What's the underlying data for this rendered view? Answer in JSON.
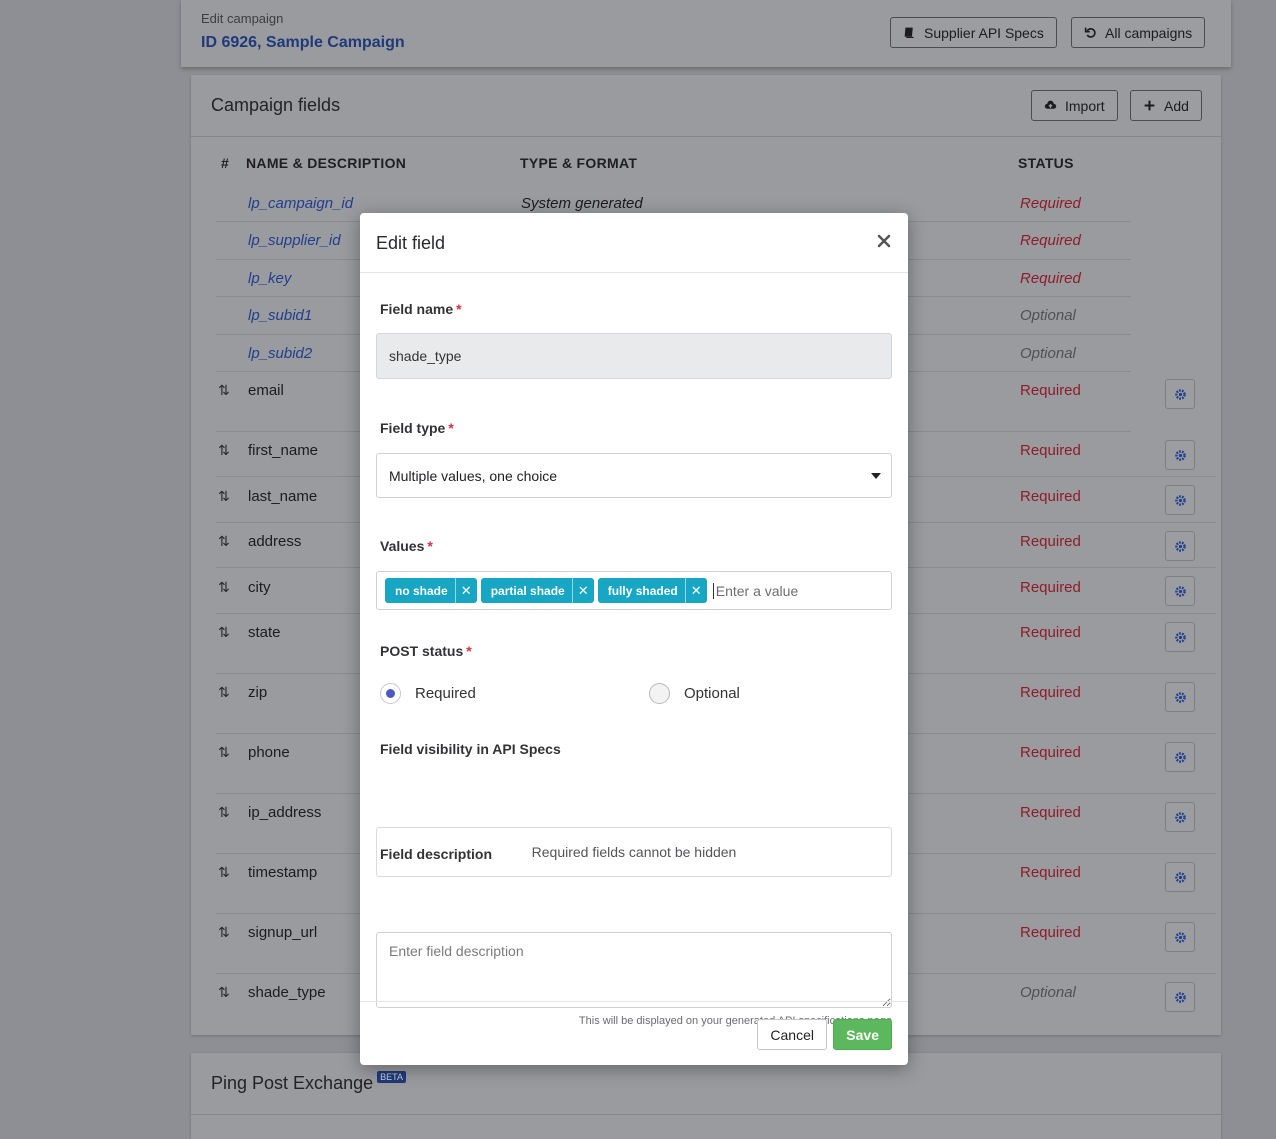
{
  "header": {
    "eyebrow": "Edit campaign",
    "title": "ID 6926, Sample Campaign",
    "api_specs_label": "Supplier API Specs",
    "all_campaigns_label": "All campaigns"
  },
  "fields_card": {
    "title": "Campaign fields",
    "import_label": "Import",
    "add_label": "Add",
    "columns": {
      "num": "#",
      "name": "NAME & DESCRIPTION",
      "type": "TYPE & FORMAT",
      "status": "STATUS"
    },
    "system_rows": [
      {
        "name": "lp_campaign_id",
        "type": "System generated",
        "status": "Required"
      },
      {
        "name": "lp_supplier_id",
        "type": "",
        "status": "Required"
      },
      {
        "name": "lp_key",
        "type": "",
        "status": "Required"
      },
      {
        "name": "lp_subid1",
        "type": "",
        "status": "Optional"
      },
      {
        "name": "lp_subid2",
        "type": "",
        "status": "Optional"
      }
    ],
    "rows": [
      {
        "name": "email",
        "status": "Required"
      },
      {
        "name": "first_name",
        "status": "Required"
      },
      {
        "name": "last_name",
        "status": "Required"
      },
      {
        "name": "address",
        "status": "Required"
      },
      {
        "name": "city",
        "status": "Required"
      },
      {
        "name": "state",
        "status": "Required"
      },
      {
        "name": "zip",
        "status": "Required"
      },
      {
        "name": "phone",
        "status": "Required"
      },
      {
        "name": "ip_address",
        "status": "Required"
      },
      {
        "name": "timestamp",
        "status": "Required"
      },
      {
        "name": "signup_url",
        "status": "Required"
      },
      {
        "name": "shade_type",
        "status": "Optional"
      }
    ]
  },
  "ping_card": {
    "title": "Ping Post Exchange",
    "badge": "BETA"
  },
  "modal": {
    "title": "Edit field",
    "field_name_label": "Field name",
    "field_name_value": "shade_type",
    "field_type_label": "Field type",
    "field_type_value": "Multiple values, one choice",
    "values_label": "Values",
    "values": [
      "no shade",
      "partial shade",
      "fully shaded"
    ],
    "values_placeholder": "Enter a value",
    "post_status_label": "POST status",
    "post_status_options": [
      "Required",
      "Optional"
    ],
    "post_status_selected": "Required",
    "visibility_label": "Field visibility in API Specs",
    "visibility_text": "Required fields cannot be hidden",
    "description_label": "Field description",
    "description_placeholder": "Enter field description",
    "description_hint": "This will be displayed on your generated API specifications page",
    "cancel_label": "Cancel",
    "save_label": "Save",
    "required_marker": "*"
  },
  "colors": {
    "tag_bg": "#17a7c4",
    "save_bg": "#5cb85c",
    "radio_accent": "#4c5ac2",
    "required_text": "#8d1d2b",
    "link": "#1f3a7a"
  }
}
